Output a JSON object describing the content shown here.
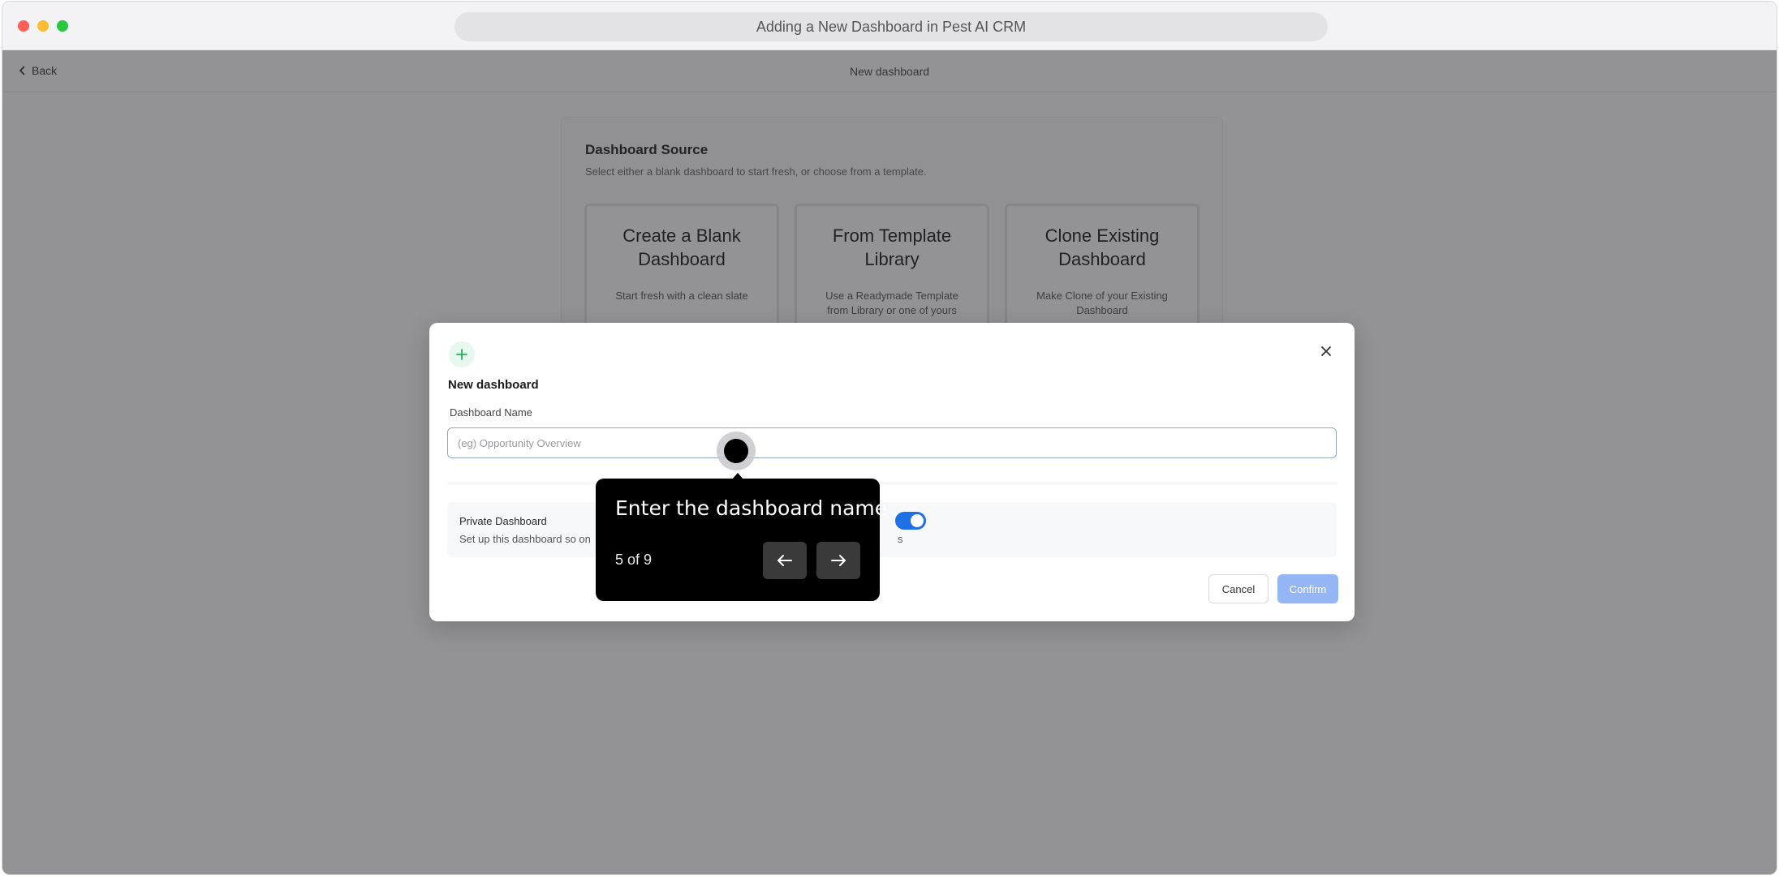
{
  "window": {
    "title": "Adding a New Dashboard in Pest AI CRM"
  },
  "header": {
    "back_label": "Back",
    "title": "New dashboard"
  },
  "source": {
    "title": "Dashboard Source",
    "description": "Select either a blank dashboard to start fresh, or choose from a template.",
    "options": [
      {
        "title": "Create a Blank Dashboard",
        "description": "Start fresh with a clean slate"
      },
      {
        "title": "From Template Library",
        "description": "Use a Readymade Template from Library or one of yours"
      },
      {
        "title": "Clone Existing Dashboard",
        "description": "Make Clone of your Existing Dashboard"
      }
    ]
  },
  "modal": {
    "title": "New dashboard",
    "name_label": "Dashboard Name",
    "name_placeholder": "(eg) Opportunity Overview",
    "name_value": "",
    "private_title": "Private Dashboard",
    "private_description_start": "Set up this dashboard so on",
    "private_description_end": "s",
    "private_enabled": true,
    "cancel_label": "Cancel",
    "confirm_label": "Confirm"
  },
  "tour": {
    "text": "Enter the dashboard name",
    "step": "5 of 9"
  },
  "colors": {
    "accent": "#1f6fe5",
    "confirm_disabled": "#95b6f5",
    "plus_green": "#22b15e"
  }
}
